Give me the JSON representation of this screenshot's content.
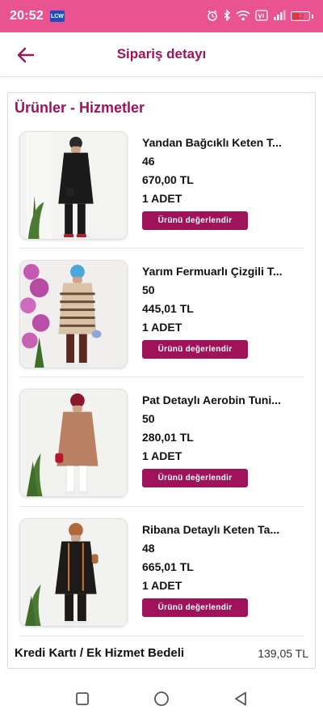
{
  "status_bar": {
    "time": "20:52",
    "app_badge": "LCW",
    "battery_level": "12"
  },
  "header": {
    "title": "Sipariş detayı"
  },
  "section": {
    "title": "Ürünler - Hizmetler"
  },
  "products": [
    {
      "name": "Yandan Bağcıklı Keten T...",
      "size": "46",
      "price": "670,00 TL",
      "quantity": "1 ADET",
      "rate_label": "Ürünü değerlendir",
      "garment_color": "#1a1a1a"
    },
    {
      "name": "Yarım Fermuarlı Çizgili T...",
      "size": "50",
      "price": "445,01 TL",
      "quantity": "1 ADET",
      "rate_label": "Ürünü değerlendir",
      "garment_color": "#d9c3a6"
    },
    {
      "name": "Pat Detaylı Aerobin Tuni...",
      "size": "50",
      "price": "280,01 TL",
      "quantity": "1 ADET",
      "rate_label": "Ürünü değerlendir",
      "garment_color": "#b98063"
    },
    {
      "name": "Ribana Detaylı Keten Ta...",
      "size": "48",
      "price": "665,01 TL",
      "quantity": "1 ADET",
      "rate_label": "Ürünü değerlendir",
      "garment_color": "#1e1a18"
    }
  ],
  "fee": {
    "label": "Kredi Kartı / Ek Hizmet Bedeli",
    "value": "139,05 TL"
  },
  "colors": {
    "status_bar": "#e9538f",
    "accent": "#a0125a"
  }
}
